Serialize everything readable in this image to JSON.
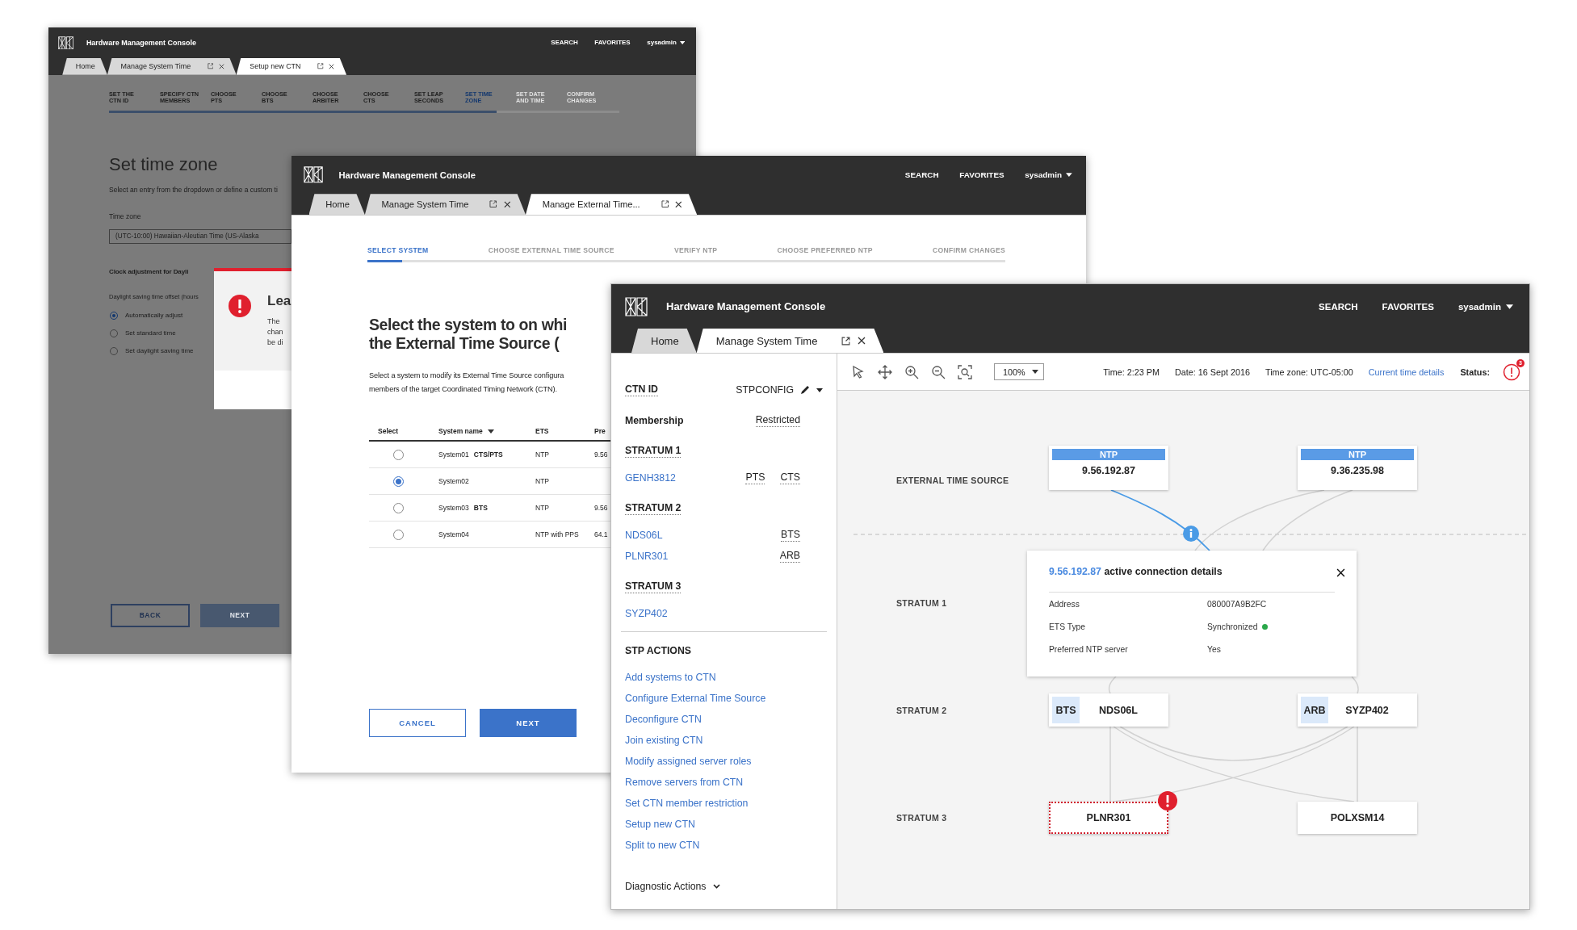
{
  "windows": [
    {
      "kind": "setup",
      "header": {
        "title": "Hardware Management Console",
        "links": [
          "SEARCH",
          "FAVORITES"
        ],
        "user": "sysadmin"
      },
      "tabs": [
        {
          "label": "Home",
          "selected": false,
          "closable": false
        },
        {
          "label": "Manage System Time",
          "selected": false,
          "closable": true
        },
        {
          "label": "Setup new CTN",
          "selected": true,
          "closable": true
        }
      ],
      "steps": [
        {
          "lines": [
            "SET THE",
            "CTN ID"
          ],
          "selected": false
        },
        {
          "lines": [
            "SPECIFY CTN",
            "MEMBERS"
          ],
          "selected": false
        },
        {
          "lines": [
            "CHOOSE",
            "PTS"
          ],
          "selected": false
        },
        {
          "lines": [
            "CHOOSE",
            "BTS"
          ],
          "selected": false
        },
        {
          "lines": [
            "CHOOSE",
            "ARBITER"
          ],
          "selected": false
        },
        {
          "lines": [
            "CHOOSE",
            "CTS"
          ],
          "selected": false
        },
        {
          "lines": [
            "SET LEAP",
            "SECONDS"
          ],
          "selected": false
        },
        {
          "lines": [
            "SET TIME",
            "ZONE"
          ],
          "selected": true
        },
        {
          "lines": [
            "SET DATE",
            "AND TIME"
          ],
          "selected": false
        },
        {
          "lines": [
            "CONFIRM",
            "CHANGES"
          ],
          "selected": false
        }
      ],
      "progress": {
        "level": 0.76
      },
      "page_title": "Set time zone",
      "description": "Select an entry from the dropdown or define a custom ti",
      "time_zone": {
        "label": "Time zone",
        "value": "(UTC-10:00) Hawaiian-Aleutian Time (US-Alaska"
      },
      "section_title": "Clock adjustment for Dayli",
      "offset_label": "Daylight saving time offset (hours",
      "options": [
        {
          "label": "Automatically adjust",
          "selected": true
        },
        {
          "label": "Set standard time",
          "selected": false
        },
        {
          "label": "Set daylight saving time",
          "selected": false
        }
      ],
      "buttons": [
        {
          "label": "BACK",
          "kind": "back"
        },
        {
          "label": "NEXT",
          "kind": "next"
        }
      ],
      "dialog": {
        "title": "Lea",
        "lines": [
          "The",
          "chan",
          "be di"
        ]
      }
    },
    {
      "kind": "ets",
      "header": {
        "title": "Hardware Management Console",
        "links": [
          "SEARCH",
          "FAVORITES"
        ],
        "user": "sysadmin"
      },
      "tabs": [
        {
          "label": "Home",
          "selected": false,
          "closable": false
        },
        {
          "label": "Manage System Time",
          "selected": false,
          "closable": true
        },
        {
          "label": "Manage External Time...",
          "selected": true,
          "closable": true
        }
      ],
      "steps": [
        {
          "lines": [
            "SELECT SYSTEM"
          ],
          "selected": true
        },
        {
          "lines": [
            "CHOOSE EXTERNAL TIME SOURCE"
          ],
          "selected": false
        },
        {
          "lines": [
            "VERIFY NTP"
          ],
          "selected": false
        },
        {
          "lines": [
            "CHOOSE PREFERRED NTP"
          ],
          "selected": false
        },
        {
          "lines": [
            "CONFIRM CHANGES"
          ],
          "selected": false
        }
      ],
      "progress": {
        "level": 0.055
      },
      "heading_lines": [
        "Select the system to on whi",
        "the External Time Source ("
      ],
      "description_lines": [
        "Select a system to modify its External Time Source configura",
        "members of the target Coordinated Timing Network (CTN)."
      ],
      "table": {
        "columns": [
          {
            "label": "Select",
            "sorted": false
          },
          {
            "label": "System name",
            "sorted": true
          },
          {
            "label": "ETS",
            "sorted": false
          },
          {
            "label": "Pre",
            "sorted": false
          }
        ],
        "rows": [
          {
            "selected": false,
            "name": "System01",
            "role": "CTS/PTS",
            "ets": "NTP",
            "column_4": "9.56"
          },
          {
            "selected": true,
            "name": "System02",
            "ets": "NTP"
          },
          {
            "selected": false,
            "name": "System03",
            "role": "BTS",
            "ets": "NTP",
            "column_4": "9.56"
          },
          {
            "selected": false,
            "name": "System04",
            "ets": "NTP with PPS",
            "column_4": "64.1"
          }
        ]
      },
      "buttons": [
        {
          "label": "CANCEL",
          "kind": "cancel"
        },
        {
          "label": "NEXT",
          "kind": "next"
        }
      ]
    },
    {
      "kind": "system_time",
      "header": {
        "title": "Hardware Management Console",
        "links": [
          "SEARCH",
          "FAVORITES"
        ],
        "user": "sysadmin"
      },
      "tabs": [
        {
          "label": "Home",
          "selected": false,
          "closable": false
        },
        {
          "label": "Manage System Time",
          "selected": true,
          "closable": true
        }
      ],
      "ctn": {
        "label": "CTN ID",
        "value": "STPCONFIG"
      },
      "membership": {
        "label": "Membership",
        "value": "Restricted"
      },
      "strata": [
        {
          "title": "STRATUM 1",
          "members": [
            {
              "name": "GENH3812",
              "roles": [
                "PTS",
                "CTS"
              ]
            }
          ]
        },
        {
          "title": "STRATUM 2",
          "members": [
            {
              "name": "NDS06L",
              "roles": [
                "BTS"
              ]
            },
            {
              "name": "PLNR301",
              "roles": [
                "ARB"
              ]
            }
          ]
        },
        {
          "title": "STRATUM 3",
          "members": [
            {
              "name": "SYZP402"
            }
          ]
        }
      ],
      "actions": {
        "title": "STP ACTIONS",
        "links": [
          "Add systems to CTN",
          "Configure External Time Source",
          "Deconfigure CTN",
          "Join existing CTN",
          "Modify assigned server roles",
          "Remove servers from CTN",
          "Set CTN member restriction",
          "Setup new CTN",
          "Split to new CTN"
        ]
      },
      "diagnostic": "Diagnostic Actions",
      "toolbar": {
        "zoom": "100%",
        "time": "Time: 2:23 PM",
        "date": "Date: 16 Sept 2016",
        "timezone": "Time zone: UTC-05:00",
        "link": "Current time details",
        "status_label": "Status:",
        "status_count": "3"
      },
      "diagram": {
        "levels": [
          "EXTERNAL TIME SOURCE",
          "STRATUM 1",
          "STRATUM 2",
          "STRATUM 3"
        ],
        "nodes": [
          {
            "kind": "ntp",
            "tag": "NTP",
            "name": "9.56.192.87",
            "error": false
          },
          {
            "kind": "ntp",
            "tag": "NTP",
            "name": "9.36.235.98",
            "error": false
          },
          {
            "kind": "member",
            "tag": "BTS",
            "name": "NDS06L",
            "error": false
          },
          {
            "kind": "member",
            "tag": "ARB",
            "name": "SYZP402",
            "error": false
          },
          {
            "kind": "plain",
            "name": "PLNR301",
            "error": true
          },
          {
            "kind": "plain",
            "name": "POLXSM14",
            "error": false
          }
        ],
        "popup": {
          "address": "9.56.192.87",
          "title": "active connection details",
          "rows": [
            {
              "label": "Address",
              "value": "080007A9B2FC"
            },
            {
              "label": "ETS Type",
              "value": "Synchronized",
              "color": "#2aa84a"
            },
            {
              "label": "Preferred NTP server",
              "value": "Yes"
            }
          ]
        }
      }
    }
  ]
}
